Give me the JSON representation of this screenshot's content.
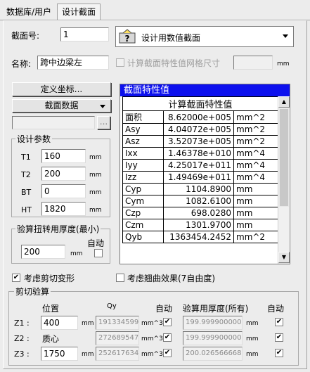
{
  "tabs": [
    {
      "label": "数据库/用户"
    },
    {
      "label": "设计截面"
    }
  ],
  "section_no": {
    "label": "截面号:",
    "value": "1"
  },
  "section_type": {
    "value": "设计用数值截面"
  },
  "name": {
    "label": "名称:",
    "value": "跨中边梁左"
  },
  "mesh": {
    "label": "计算截面特性值网格尺寸",
    "value": "",
    "unit": "mm"
  },
  "buttons": {
    "define_coords": "定义坐标...",
    "section_data": "截面数据",
    "browse": "..."
  },
  "design_params": {
    "title": "设计参数",
    "rows": [
      {
        "label": "T1",
        "value": "160",
        "unit": "mm"
      },
      {
        "label": "T2",
        "value": "200",
        "unit": "mm"
      },
      {
        "label": "BT",
        "value": "0",
        "unit": "mm"
      },
      {
        "label": "HT",
        "value": "1820",
        "unit": "mm"
      }
    ]
  },
  "torsion": {
    "title": "验算扭转用厚度(最小)",
    "value": "200",
    "unit": "mm",
    "auto_label": "自动"
  },
  "properties": {
    "title": "截面特性值",
    "header": "计算截面特性值",
    "rows": [
      {
        "name": "面积",
        "value": "8.62000e+005",
        "unit": "mm^2"
      },
      {
        "name": "Asy",
        "value": "4.04072e+005",
        "unit": "mm^2"
      },
      {
        "name": "Asz",
        "value": "3.52073e+005",
        "unit": "mm^2"
      },
      {
        "name": "Ixx",
        "value": "1.46378e+010",
        "unit": "mm^4"
      },
      {
        "name": "Iyy",
        "value": "4.25017e+011",
        "unit": "mm^4"
      },
      {
        "name": "Izz",
        "value": "1.49469e+011",
        "unit": "mm^4"
      },
      {
        "name": "Cyp",
        "value": "1104.8900",
        "unit": "mm"
      },
      {
        "name": "Cym",
        "value": "1082.6100",
        "unit": "mm"
      },
      {
        "name": "Czp",
        "value": "698.0280",
        "unit": "mm"
      },
      {
        "name": "Czm",
        "value": "1301.9700",
        "unit": "mm"
      },
      {
        "name": "Qyb",
        "value": "1363454.2452",
        "unit": "mm^2"
      }
    ]
  },
  "options": {
    "shear_deform": "考虑剪切变形",
    "warping": "考虑翘曲效果(7自由度)",
    "shear_deform_checked": true,
    "warping_checked": false
  },
  "shear": {
    "title": "剪切验算",
    "col_position": "位置",
    "col_qy": "Qy",
    "col_auto": "自动",
    "col_thickness": "验算用厚度(所有)",
    "col_auto2": "自动",
    "rows": [
      {
        "label": "Z1 :",
        "position": "400",
        "position_unit": "mm",
        "qy": "191334599",
        "qy_unit": "mm^3",
        "thickness": "199.999900000",
        "thickness_unit": "mm"
      },
      {
        "label": "Z2 :",
        "position": "质心",
        "position_unit": "",
        "qy": "272689547",
        "qy_unit": "mm^3",
        "thickness": "199.999900000",
        "thickness_unit": "mm"
      },
      {
        "label": "Z3 :",
        "position": "1750",
        "position_unit": "mm",
        "qy": "252617634",
        "qy_unit": "mm^3",
        "thickness": "200.026566668",
        "thickness_unit": "mm"
      }
    ]
  }
}
